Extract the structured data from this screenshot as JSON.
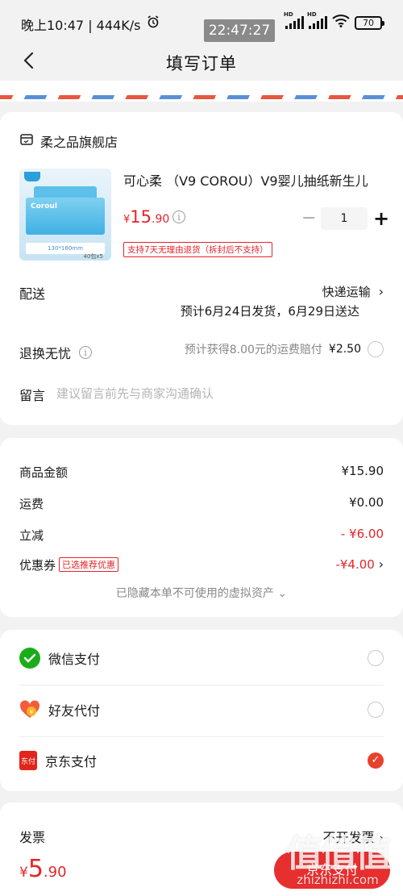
{
  "status_bar": {
    "time_speed": "晚上10:47 | 444K/s",
    "overlay_time": "22:47:27",
    "net_label_1": "HD",
    "net_label_2": "HD",
    "battery": "70"
  },
  "nav": {
    "title": "填写订单"
  },
  "store": {
    "name": "柔之品旗舰店"
  },
  "product": {
    "title": "可心柔 （V9 COROU）V9婴儿抽纸新生儿",
    "image_text_brand": "Coroul",
    "image_text_size": "130*180mm",
    "image_text_count": "40包x5",
    "price_currency": "¥",
    "price_int": "15",
    "price_dec": ".90",
    "quantity": "1",
    "badge": "支持7天无理由退货（拆封后不支持）"
  },
  "delivery": {
    "label": "配送",
    "method": "快递运输",
    "eta": "预计6月24日发货，6月29日送达"
  },
  "return": {
    "label": "退换无忧",
    "desc": "预计获得8.00元的运费赔付",
    "price": "¥2.50"
  },
  "message": {
    "label": "留言",
    "placeholder": "建议留言前先与商家沟通确认"
  },
  "summary": {
    "goods_label": "商品金额",
    "goods_value": "¥15.90",
    "shipping_label": "运费",
    "shipping_value": "¥0.00",
    "discount_label": "立减",
    "discount_value": "- ¥6.00",
    "coupon_label": "优惠券",
    "coupon_badge": "已选推荐优惠",
    "coupon_value": "-¥4.00",
    "hidden_note": "已隐藏本单不可使用的虚拟资产"
  },
  "payment": {
    "methods": [
      {
        "label": "微信支付",
        "icon": "wechat-pay-icon",
        "selected": false,
        "color": "#1aad19"
      },
      {
        "label": "好友代付",
        "icon": "friend-pay-icon",
        "selected": false,
        "color": "#f25c3c"
      },
      {
        "label": "京东支付",
        "icon": "jd-pay-icon",
        "icon_text": "东付",
        "selected": true,
        "color": "#e1251b"
      }
    ]
  },
  "invoice": {
    "label": "发票",
    "value": "不开发票"
  },
  "footer": {
    "total_currency": "¥",
    "total_int": "5",
    "total_dec": ".90",
    "pay_button": "京东支付"
  },
  "watermark": {
    "logo": "值值值",
    "url": "zhizhizhi.com"
  },
  "colors": {
    "accent_red": "#e3242b",
    "button_red": "#e82f2f",
    "background": "#f2f2f2"
  }
}
